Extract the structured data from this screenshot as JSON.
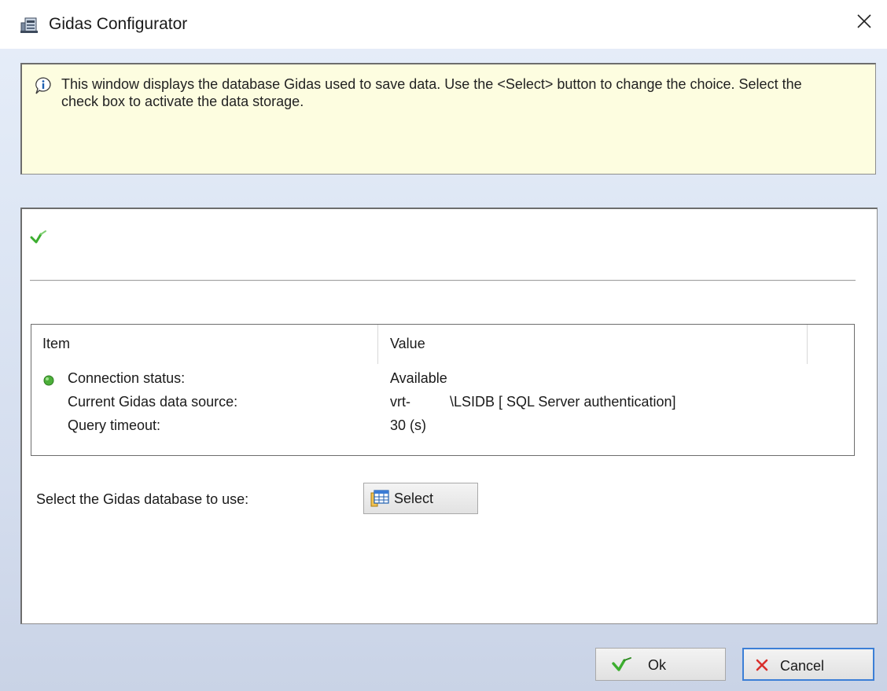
{
  "window": {
    "title": "Gidas Configurator",
    "icon": "database-config-icon",
    "close_icon": "close-icon"
  },
  "info_panel": {
    "icon": "info-speech-icon",
    "text": "This window displays the database Gidas used to save data. Use the <Select> button to change the choice. Select the check box to activate the data storage."
  },
  "status": {
    "check_icon": "green-check-icon",
    "check_color": "#3cae2f"
  },
  "grid": {
    "columns": [
      "Item",
      "Value"
    ],
    "rows": [
      {
        "label": "Connection status:",
        "value": "Available",
        "indicator": "green-status-dot-icon",
        "indicator_color": "#4caf3a"
      },
      {
        "label": "Current Gidas data source:",
        "value": "vrt-          \\LSIDB [ SQL Server authentication]"
      },
      {
        "label": "Query timeout:",
        "value": "30 (s)"
      }
    ]
  },
  "select_section": {
    "label": "Select the Gidas database to use:",
    "button_label": "Select",
    "button_icon": "table-select-icon"
  },
  "footer": {
    "ok_label": "Ok",
    "ok_icon": "green-check-icon",
    "cancel_label": "Cancel",
    "cancel_icon": "red-x-icon",
    "cancel_focus_color": "#3c7fd6"
  }
}
